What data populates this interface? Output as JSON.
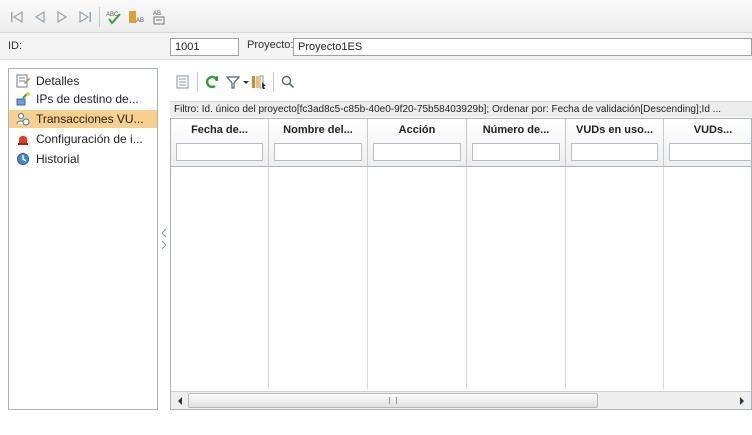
{
  "toolbar": {
    "icons": [
      "first-record-icon",
      "previous-record-icon",
      "next-record-icon",
      "last-record-icon",
      "spell-check-icon",
      "spelling-options-icon",
      "thesaurus-icon"
    ]
  },
  "record": {
    "id_label": "ID:",
    "id_value": "1001",
    "project_label": "Proyecto:",
    "project_value": "Proyecto1ES"
  },
  "sidebar": {
    "items": [
      {
        "label": "Detalles",
        "icon": "details-icon",
        "selected": false
      },
      {
        "label": "IPs de destino de...",
        "icon": "network-ip-icon",
        "selected": false
      },
      {
        "label": "Transacciones VU...",
        "icon": "transactions-icon",
        "selected": true
      },
      {
        "label": "Configuración de i...",
        "icon": "configuration-icon",
        "selected": false
      },
      {
        "label": "Historial",
        "icon": "history-icon",
        "selected": false
      }
    ]
  },
  "grid_toolbar": {
    "icons": [
      "details-view-icon",
      "refresh-icon",
      "filter-icon",
      "select-columns-icon",
      "find-icon"
    ]
  },
  "filter_text": "Filtro: Id. único del proyecto[fc3ad8c5-c85b-40e0-9f20-75b58403929b]; Ordenar por: Fecha de validación[Descending];Id ...",
  "grid": {
    "columns": [
      "Fecha de...",
      "Nombre del...",
      "Acción",
      "Número de...",
      "VUDs en uso...",
      "VUDs..."
    ]
  },
  "colors": {
    "selected_item": "#f7cf8e",
    "border": "#a9b3bd",
    "toolbar_bg": "#ececec"
  }
}
